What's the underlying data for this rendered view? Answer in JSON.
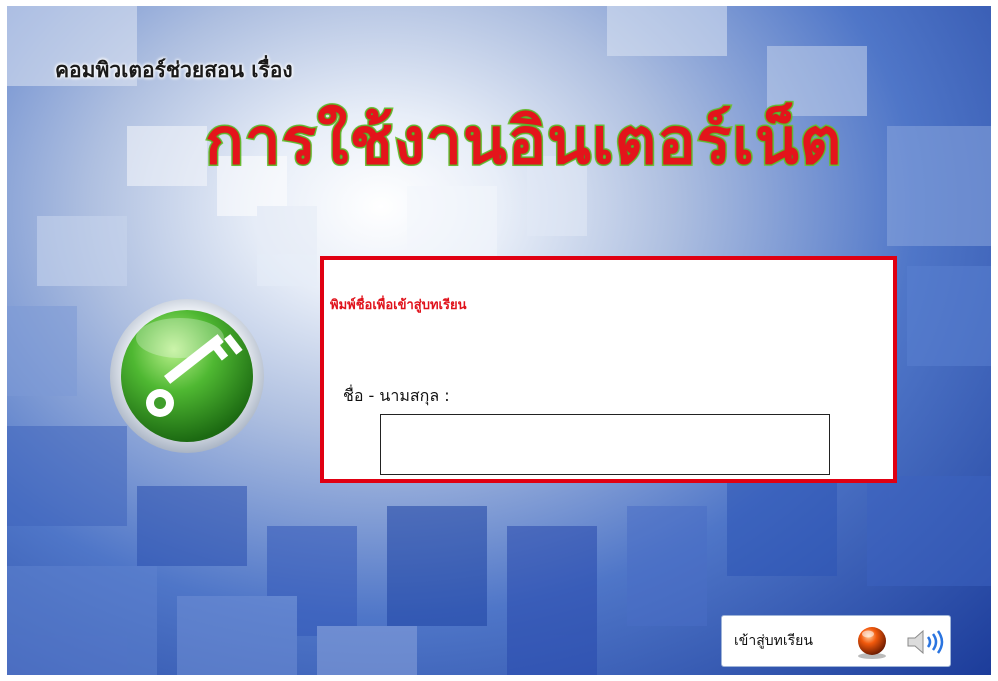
{
  "header": {
    "subtitle": "คอมพิวเตอร์ช่วยสอน เรื่อง",
    "title": "การใช้งานอินเตอร์เน็ต"
  },
  "login": {
    "prompt": "พิมพ์ชื่อเพื่อเข้าสู่บทเรียน",
    "name_label": "ชื่อ - นามสกุล :",
    "name_value": "",
    "name_placeholder": ""
  },
  "footer": {
    "enter_label": "เข้าสู่บทเรียน"
  },
  "icons": {
    "key": "key-icon",
    "enter": "orange-ball-button-icon",
    "sound": "speaker-icon"
  },
  "colors": {
    "title_fill": "#e4141b",
    "title_outline": "#74c43a",
    "panel_border": "#e00012",
    "prompt_text": "#e0131c",
    "key_badge": "#3fa42a",
    "enter_button": "#f2590c"
  }
}
